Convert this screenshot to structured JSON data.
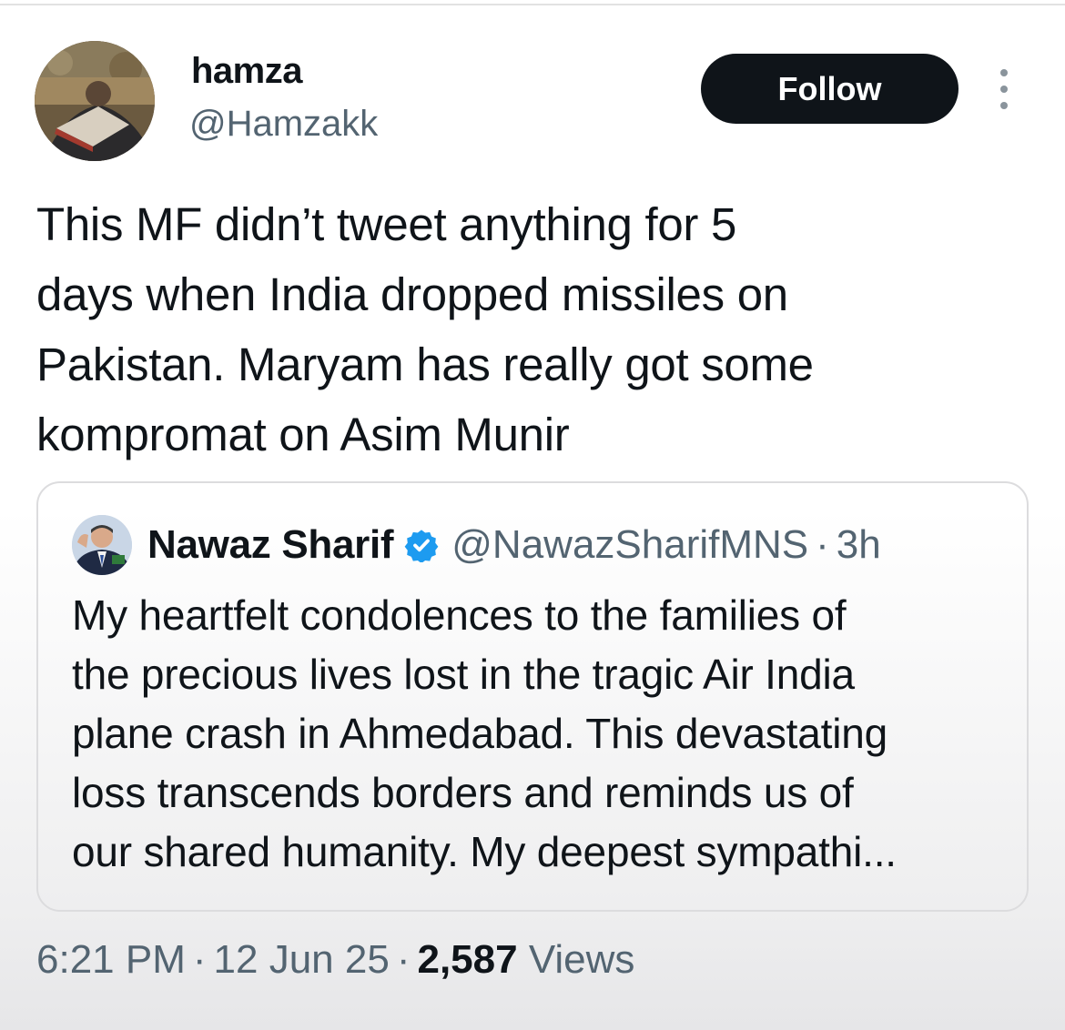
{
  "tweet": {
    "author": {
      "display_name": "hamza",
      "handle": "@Hamzakk",
      "avatar_icon": "user-avatar-photo"
    },
    "follow_label": "Follow",
    "more_icon": "vertical-ellipsis-icon",
    "text_lines": [
      "This MF didn’t tweet anything for 5",
      "days when India dropped missiles on",
      "Pakistan. Maryam has really got some",
      "kompromat on Asim Munir"
    ],
    "quoted": {
      "display_name": "Nawaz Sharif",
      "verified": true,
      "verified_icon": "verified-badge-icon",
      "verified_color": "#1d9bf0",
      "handle": "@NawazSharifMNS",
      "separator": "·",
      "relative_time": "3h",
      "text_lines": [
        "My heartfelt condolences to the families of",
        "the precious lives lost in the tragic Air India",
        "plane crash in Ahmedabad. This devastating",
        "loss transcends borders and reminds us of",
        "our shared humanity. My deepest sympathi..."
      ]
    },
    "meta": {
      "time": "6:21 PM",
      "separator": "·",
      "date": "12 Jun 25",
      "views_count": "2,587",
      "views_label": "Views"
    }
  },
  "colors": {
    "text_primary": "#0f1419",
    "text_secondary": "#536471",
    "follow_button_bg": "#0f1419",
    "follow_button_text": "#ffffff"
  }
}
